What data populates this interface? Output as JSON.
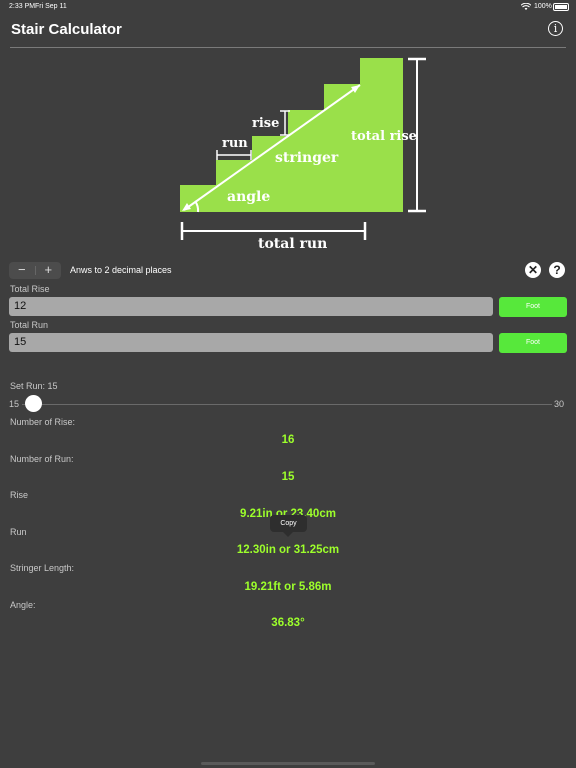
{
  "status": {
    "time": "2:33 PM",
    "date": "Fri Sep 11",
    "battery": "100%"
  },
  "header": {
    "title": "Stair Calculator",
    "info_icon": "info-icon"
  },
  "diagram": {
    "rise": "rise",
    "run": "run",
    "stringer": "stringer",
    "total_rise": "total rise",
    "angle": "angle",
    "total_run": "total run",
    "fill_color": "#9ae04a"
  },
  "controls": {
    "minus": "−",
    "plus": "+",
    "decimal_label": "Anws to 2 decimal places",
    "clear_icon": "✕",
    "help_icon": "?"
  },
  "inputs": {
    "total_rise_label": "Total Rise",
    "total_rise_value": "12",
    "total_rise_unit": "Foot",
    "total_run_label": "Total Run",
    "total_run_value": "15",
    "total_run_unit": "Foot"
  },
  "slider": {
    "label": "Set Run: 15",
    "min": "15",
    "max": "30",
    "value": 15
  },
  "results": {
    "num_rise_label": "Number of Rise:",
    "num_rise_value": "16",
    "num_run_label": "Number of Run:",
    "num_run_value": "15",
    "rise_label": "Rise",
    "rise_value": "9.21in or 23.40cm",
    "run_label": "Run",
    "run_value": "12.30in or 31.25cm",
    "stringer_label": "Stringer Length:",
    "stringer_value": "19.21ft or 5.86m",
    "angle_label": "Angle:",
    "angle_value": "36.83°"
  },
  "tooltip": "Copy",
  "colors": {
    "accent": "#9dff2b",
    "button": "#57e83b",
    "background": "#3e3e3e"
  }
}
